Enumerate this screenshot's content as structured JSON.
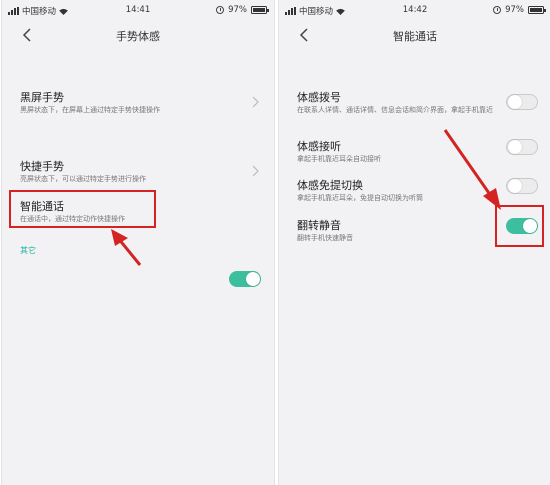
{
  "colors": {
    "accent": "#3dbf9f",
    "section_text": "#1fb59b",
    "highlight": "#d42323"
  },
  "left": {
    "status": {
      "carrier": "中国移动",
      "time": "14:41",
      "battery": "97%",
      "battery_level": 0.97
    },
    "title": "手势体感",
    "rows": [
      {
        "title": "黑屏手势",
        "desc": "黑屏状态下，在屏幕上通过特定手势快捷操作"
      },
      {
        "title": "快捷手势",
        "desc": "亮屏状态下，可以通过特定手势进行操作"
      },
      {
        "title": "智能通话",
        "desc": "在通话中，通过特定动作快捷操作"
      }
    ],
    "section_label": "其它",
    "toggle_on": true
  },
  "right": {
    "status": {
      "carrier": "中国移动",
      "time": "14:42",
      "battery": "97%",
      "battery_level": 0.97
    },
    "title": "智能通话",
    "rows": [
      {
        "title": "体感拨号",
        "desc": "在联系人详情、通话详情、信息会话和简介界面，拿起手机靠近",
        "on": false
      },
      {
        "title": "体感接听",
        "desc": "拿起手机靠近耳朵自动接听",
        "on": false
      },
      {
        "title": "体感免提切换",
        "desc": "拿起手机靠近耳朵，免提自动切换为听筒",
        "on": false
      },
      {
        "title": "翻转静音",
        "desc": "翻转手机快速静音",
        "on": true
      }
    ]
  },
  "icons": [
    "back-arrow-icon",
    "chevron-right-icon",
    "signal-icon",
    "wifi-icon",
    "alarm-icon",
    "battery-icon"
  ]
}
